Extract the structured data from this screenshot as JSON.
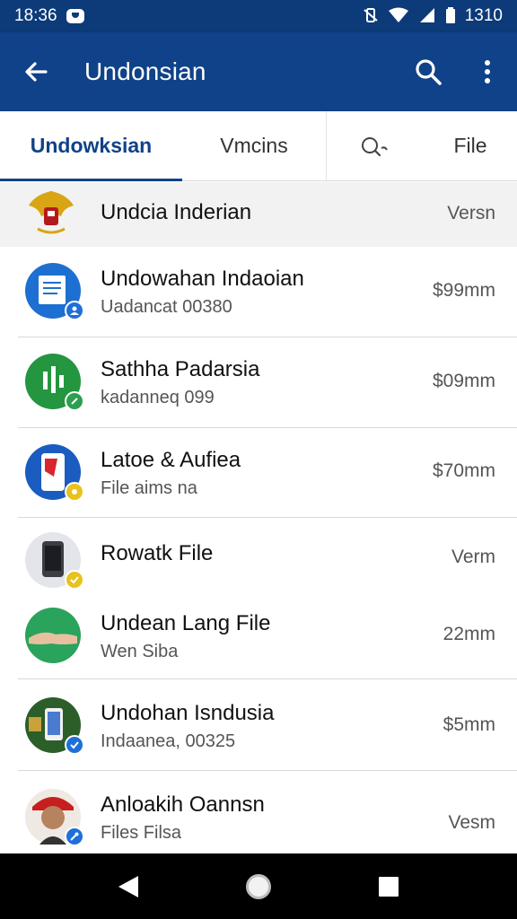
{
  "status_bar": {
    "time": "18:36",
    "right_text": "1310",
    "icons": [
      "notification-icon",
      "vibrate-icon",
      "wifi-icon",
      "signal-icon",
      "battery-icon"
    ]
  },
  "app_bar": {
    "title": "Undonsian",
    "color": "#0f4288"
  },
  "tabs": [
    {
      "label": "Undowksian",
      "active": true
    },
    {
      "label": "Vmcins",
      "active": false
    },
    {
      "label": "Q",
      "active": false
    },
    {
      "label": "File",
      "active": false
    }
  ],
  "list": {
    "header": {
      "title": "Undcia Inderian",
      "meta": "Versn"
    },
    "items": [
      {
        "title": "Undowahan Indaoian",
        "subtitle": "Uadancat 00380",
        "meta": "$99mm"
      },
      {
        "title": "Sathha Padarsia",
        "subtitle": "kadanneq 099",
        "meta": "$09mm"
      },
      {
        "title": "Latoe & Aufiea",
        "subtitle": "File aims na",
        "meta": "$70mm"
      },
      {
        "title": "Rowatk File",
        "subtitle": "",
        "meta": "Verm"
      },
      {
        "title": "Undean Lang File",
        "subtitle": "Wen Siba",
        "meta": "22mm"
      },
      {
        "title": "Undohan Isndusia",
        "subtitle": "Indaanea, 00325",
        "meta": "$5mm"
      },
      {
        "title": "Anloakih Oannsn",
        "subtitle": "Files Filsa",
        "meta": "Vesm"
      }
    ]
  },
  "colors": {
    "status_bar": "#0d3a78",
    "accent": "#0f4288",
    "badge_blue": "#1e6fd9",
    "badge_green": "#2e9e4f",
    "badge_yellow": "#e8c21d"
  }
}
